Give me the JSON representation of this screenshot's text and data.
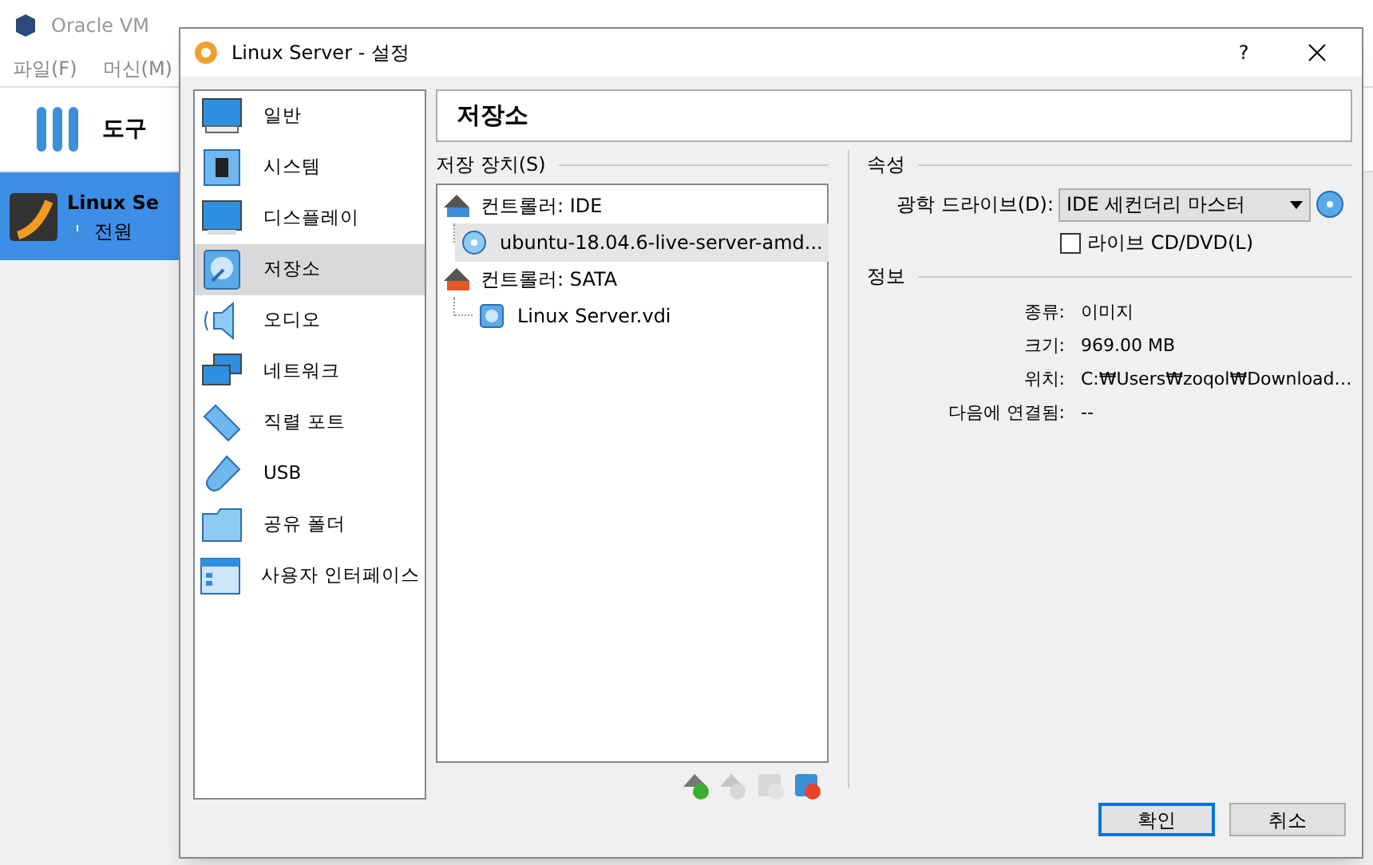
{
  "background_window": {
    "title": "Oracle VM",
    "menu": [
      "파일(F)",
      "머신(M)"
    ],
    "tools_label": "도구",
    "vm": {
      "name": "Linux Se",
      "status": "전원",
      "selected": true
    }
  },
  "dialog": {
    "title": "Linux Server - 설정",
    "help": "?",
    "categories": [
      {
        "label": "일반",
        "kind": "general",
        "selected": false
      },
      {
        "label": "시스템",
        "kind": "system",
        "selected": false
      },
      {
        "label": "디스플레이",
        "kind": "display",
        "selected": false
      },
      {
        "label": "저장소",
        "kind": "storage",
        "selected": true
      },
      {
        "label": "오디오",
        "kind": "audio",
        "selected": false
      },
      {
        "label": "네트워크",
        "kind": "network",
        "selected": false
      },
      {
        "label": "직렬 포트",
        "kind": "serial",
        "selected": false
      },
      {
        "label": "USB",
        "kind": "usb",
        "selected": false
      },
      {
        "label": "공유 폴더",
        "kind": "folder",
        "selected": false
      },
      {
        "label": "사용자 인터페이스",
        "kind": "ui",
        "selected": false
      }
    ],
    "page_title": "저장소",
    "storage": {
      "label": "저장 장치(S)",
      "tree": [
        {
          "label": "컨트롤러: IDE",
          "kind": "controller",
          "color": "#3b8fd8",
          "children": [
            {
              "label": "ubuntu-18.04.6-live-server-amd...",
              "kind": "optical",
              "selected": true
            }
          ]
        },
        {
          "label": "컨트롤러: SATA",
          "kind": "controller",
          "color": "#e05a28",
          "children": [
            {
              "label": "Linux Server.vdi",
              "kind": "disk",
              "selected": false
            }
          ]
        }
      ],
      "toolbar": [
        {
          "kind": "add_controller",
          "disabled": false
        },
        {
          "kind": "remove_controller",
          "disabled": true
        },
        {
          "kind": "add_attachment",
          "disabled": true
        },
        {
          "kind": "remove_attachment",
          "disabled": false
        }
      ]
    },
    "attributes": {
      "title": "속성",
      "drive_label": "광학 드라이브(D):",
      "drive_value": "IDE 세컨더리 마스터",
      "live_cd": {
        "label": "라이브 CD/DVD(L)",
        "checked": false
      }
    },
    "info": {
      "title": "정보",
      "rows": [
        {
          "label": "종류:",
          "value": "이미지"
        },
        {
          "label": "크기:",
          "value": "969.00 MB"
        },
        {
          "label": "위치:",
          "value": "C:₩Users₩zoqol₩Download…"
        },
        {
          "label": "다음에 연결됨:",
          "value": "--"
        }
      ]
    },
    "buttons": [
      {
        "label": "확인",
        "default": true
      },
      {
        "label": "취소",
        "default": false
      }
    ]
  }
}
